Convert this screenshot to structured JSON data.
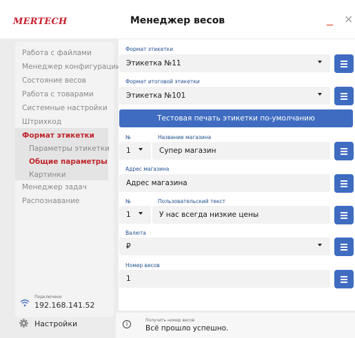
{
  "app": {
    "logo": "MERTECH",
    "title": "Менеджер весов",
    "minimize": "_",
    "close": "×"
  },
  "sidebar": {
    "items": [
      {
        "label": "Работа с файлами"
      },
      {
        "label": "Менеджер конфигурации"
      },
      {
        "label": "Состояние весов"
      },
      {
        "label": "Работа с товарами"
      },
      {
        "label": "Системные настройки"
      },
      {
        "label": "Штрихкод"
      },
      {
        "label": "Формат этикетки"
      },
      {
        "label": "Менеджер задач"
      },
      {
        "label": "Распознавание"
      }
    ],
    "subitems": [
      {
        "label": "Параметры этикетки"
      },
      {
        "label": "Общие параметры"
      },
      {
        "label": "Картинки"
      }
    ],
    "active_item": "Формат этикетки",
    "active_subitem": "Общие параметры",
    "connection": {
      "label": "Подключено",
      "ip": "192.168.141.52",
      "icon": "wifi-icon"
    },
    "settings": {
      "label": "Настройки",
      "icon": "gear-icon"
    }
  },
  "form": {
    "label_format": {
      "label": "Формат этикетки",
      "value": "Этикетка №11"
    },
    "total_label_format": {
      "label": "Формат итоговой этикетки",
      "value": "Этикетка №101"
    },
    "test_print_button": "Тестовая печать этикетки по-умолчанию",
    "store_name": {
      "number_label": "№",
      "number_value": "1",
      "label": "Название магазина",
      "value": "Супер магазин"
    },
    "store_address": {
      "label": "Адрес магазина",
      "value": "Адрес магазина"
    },
    "custom_text": {
      "number_label": "№",
      "number_value": "1",
      "label": "Пользовательский текст",
      "value": "У нас всегда низкие цены"
    },
    "currency": {
      "label": "Валюта",
      "value": "₽"
    },
    "scale_number": {
      "label": "Номер весов",
      "value": "1"
    }
  },
  "status": {
    "title": "Получить номер весов",
    "message": "Всё прошло успешно.",
    "icon": "info-icon"
  },
  "colors": {
    "accent": "#3f6cc1",
    "active": "#c0262d",
    "label": "#1f4f8f"
  }
}
